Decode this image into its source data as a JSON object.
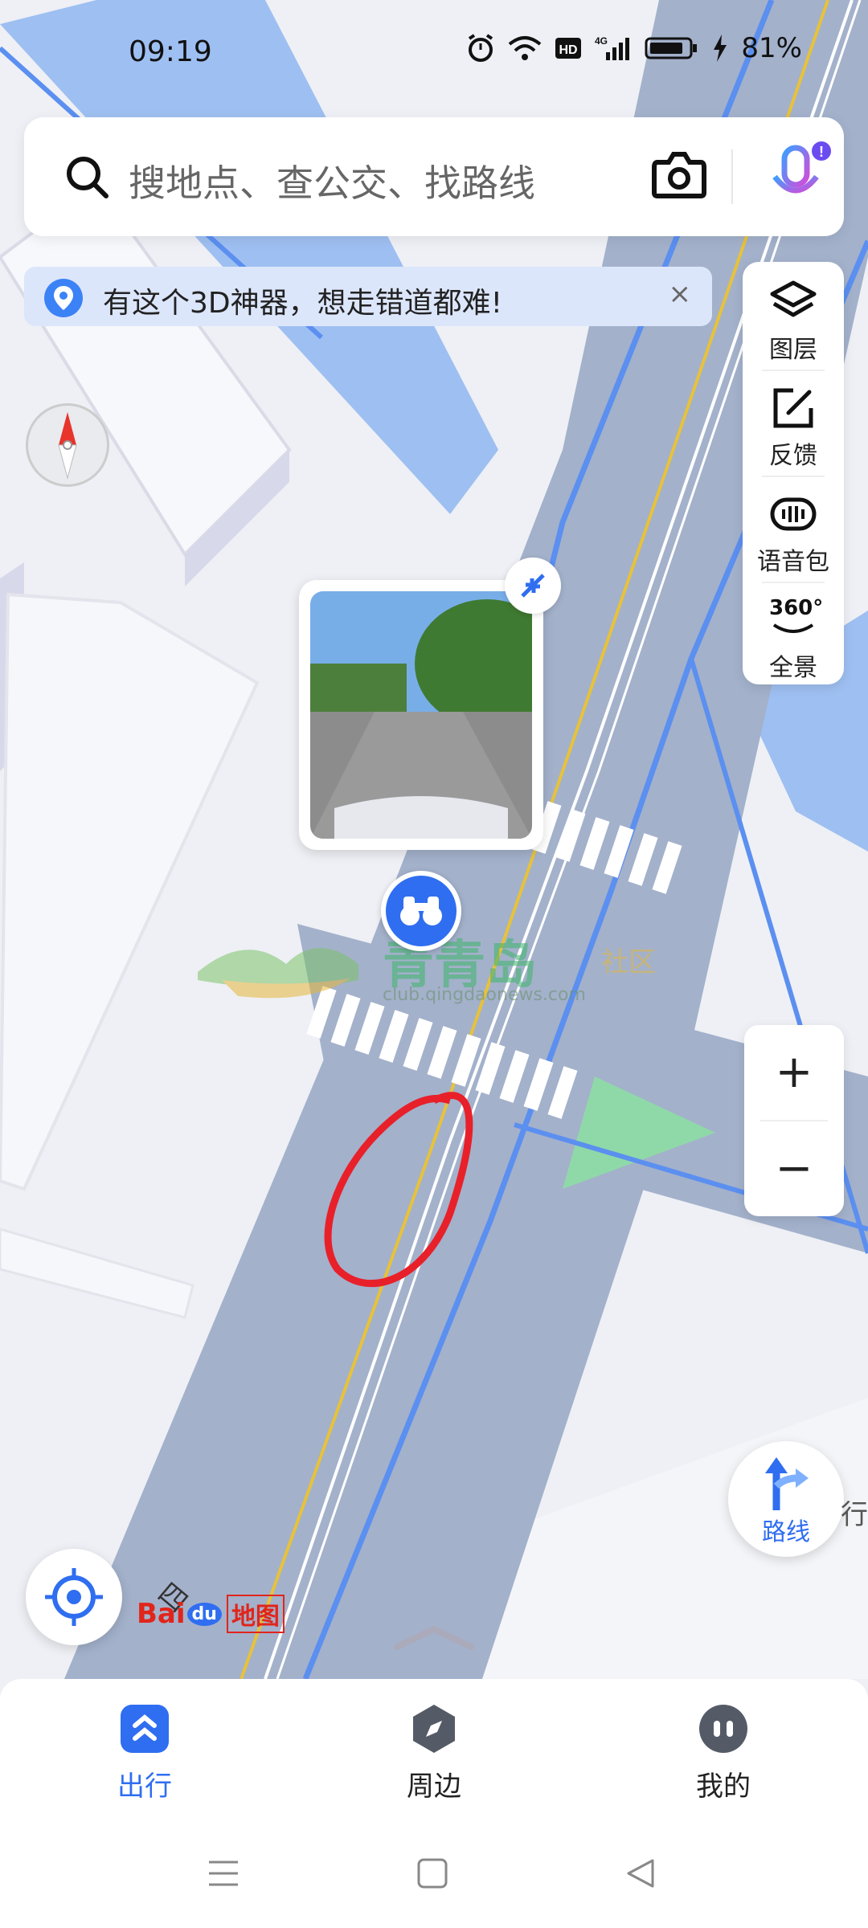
{
  "status": {
    "time": "09:19",
    "battery": "81%",
    "icons": [
      "alarm-icon",
      "wifi-icon",
      "hd-icon",
      "signal-4g-icon",
      "battery-icon"
    ]
  },
  "search": {
    "placeholder": "搜地点、查公交、找路线"
  },
  "banner": {
    "text": "有这个3D神器，想走错道都难!",
    "close": "×"
  },
  "tools": {
    "layers": "图层",
    "feedback": "反馈",
    "voice": "语音包",
    "pano": "全景",
    "pano_icon_text": "360°"
  },
  "watermark": {
    "text": "青青岛",
    "sub": "社区",
    "url": "club.qingdaonews.com"
  },
  "zoom": {
    "in": "+",
    "out": "−"
  },
  "route": {
    "label": "路线",
    "side": "行"
  },
  "road_label": "四",
  "logo": {
    "bai": "Bai",
    "du": "du",
    "map": "地图"
  },
  "nav": {
    "travel": "出行",
    "nearby": "周边",
    "mine": "我的"
  },
  "colors": {
    "accent": "#2f6ef0",
    "road": "#a3b1cb",
    "water": "#8fb6f0",
    "green": "#8fd9a8"
  }
}
